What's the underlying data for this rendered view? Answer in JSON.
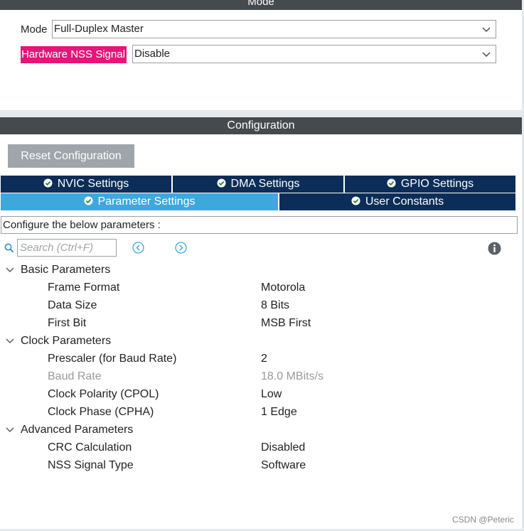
{
  "mode_section": {
    "header": "Mode",
    "mode_label": "Mode",
    "mode_value": "Full-Duplex Master",
    "nss_label": "Hardware NSS Signal",
    "nss_value": "Disable"
  },
  "config_section": {
    "header": "Configuration",
    "reset_label": "Reset Configuration",
    "tabs": [
      {
        "label": "NVIC Settings",
        "active": false
      },
      {
        "label": "DMA Settings",
        "active": false
      },
      {
        "label": "GPIO Settings",
        "active": false
      },
      {
        "label": "Parameter Settings",
        "active": true
      },
      {
        "label": "User Constants",
        "active": false
      }
    ],
    "instruction": "Configure the below parameters :",
    "search": {
      "placeholder": "Search (Ctrl+F)",
      "value": ""
    }
  },
  "groups": [
    {
      "label": "Basic Parameters",
      "params": [
        {
          "name": "Frame Format",
          "value": "Motorola",
          "disabled": false
        },
        {
          "name": "Data Size",
          "value": "8 Bits",
          "disabled": false
        },
        {
          "name": "First Bit",
          "value": "MSB First",
          "disabled": false
        }
      ]
    },
    {
      "label": "Clock Parameters",
      "params": [
        {
          "name": "Prescaler (for Baud Rate)",
          "value": "2",
          "disabled": false
        },
        {
          "name": "Baud Rate",
          "value": "18.0 MBits/s",
          "disabled": true
        },
        {
          "name": "Clock Polarity (CPOL)",
          "value": "Low",
          "disabled": false
        },
        {
          "name": "Clock Phase (CPHA)",
          "value": "1 Edge",
          "disabled": false
        }
      ]
    },
    {
      "label": "Advanced Parameters",
      "params": [
        {
          "name": "CRC Calculation",
          "value": "Disabled",
          "disabled": false
        },
        {
          "name": "NSS Signal Type",
          "value": "Software",
          "disabled": false
        }
      ]
    }
  ],
  "watermark": "CSDN @Peteric",
  "icons": {
    "dropdown": "chevron-down-icon",
    "tab_status": "check-circle-icon",
    "search": "search-icon",
    "prev": "previous-icon",
    "next": "next-icon",
    "info": "info-icon",
    "group_toggle": "chevron-down-icon"
  },
  "colors": {
    "header_bg": "#454a4e",
    "tab_bg": "#0c2d57",
    "tab_active_bg": "#3ea7dc",
    "highlight": "#e3167b",
    "button_bg": "#9fa5aa",
    "accent_icon": "#3ea7dc"
  }
}
